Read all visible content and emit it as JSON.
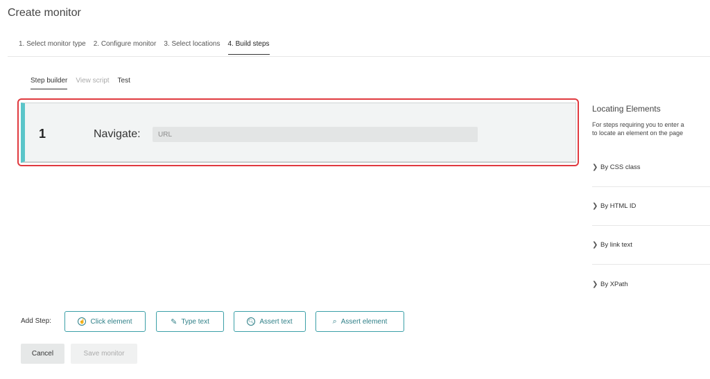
{
  "page": {
    "title": "Create monitor"
  },
  "wizard": {
    "steps": [
      {
        "label": "1. Select monitor type"
      },
      {
        "label": "2. Configure monitor"
      },
      {
        "label": "3. Select locations"
      },
      {
        "label": "4. Build steps",
        "active": true
      }
    ]
  },
  "subtabs": [
    {
      "label": "Step builder",
      "active": true
    },
    {
      "label": "View script"
    },
    {
      "label": "Test"
    }
  ],
  "step": {
    "number": "1",
    "action": "Navigate:",
    "url_placeholder": "URL",
    "url_value": ""
  },
  "sidebar": {
    "title": "Locating Elements",
    "desc_line1": "For steps requiring you to enter a",
    "desc_line2": "to locate an element on the page",
    "items": [
      {
        "label": "By CSS class"
      },
      {
        "label": "By HTML ID"
      },
      {
        "label": "By link text"
      },
      {
        "label": "By XPath"
      }
    ]
  },
  "add_step": {
    "label": "Add Step:",
    "buttons": [
      {
        "label": "Click element",
        "icon": "click-icon"
      },
      {
        "label": "Type text",
        "icon": "type-text-icon"
      },
      {
        "label": "Assert text",
        "icon": "assert-text-icon"
      },
      {
        "label": "Assert element",
        "icon": "search-icon"
      }
    ]
  },
  "footer": {
    "cancel_label": "Cancel",
    "save_label": "Save monitor"
  },
  "colors": {
    "accent": "#5bc5c9",
    "highlight": "#e0393e",
    "button_text": "#2e7f87"
  }
}
